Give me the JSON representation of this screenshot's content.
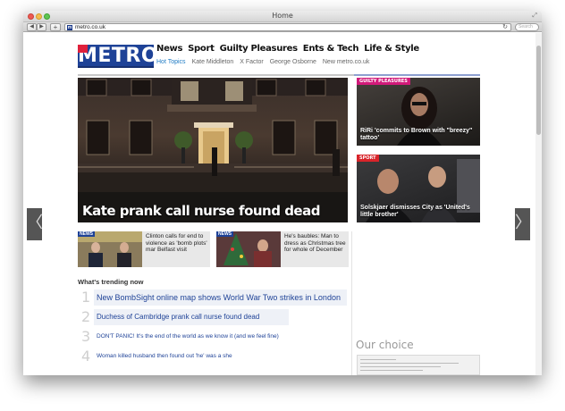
{
  "window": {
    "title": "Home"
  },
  "toolbar": {
    "url": "metro.co.uk",
    "search_placeholder": "Search",
    "favicon": "m"
  },
  "logo": {
    "text": "METRO"
  },
  "nav": {
    "main": [
      "News",
      "Sport",
      "Guilty Pleasures",
      "Ents & Tech",
      "Life & Style"
    ],
    "sub": [
      "Hot Topics",
      "Kate Middleton",
      "X Factor",
      "George Osborne",
      "New metro.co.uk"
    ]
  },
  "hero": {
    "headline": "Kate prank call nurse found dead"
  },
  "promos": [
    {
      "tag": "GUILTY PLEASURES",
      "caption": "RiRi 'commits to Brown with \"breezy\" tattoo'"
    },
    {
      "tag": "SPORT",
      "caption": "Solskjaer dismisses City as 'United's little brother'"
    }
  ],
  "cards": [
    {
      "tag": "NEWS",
      "text": "Clinton calls for end to violence as 'bomb plots' mar Belfast visit"
    },
    {
      "tag": "NEWS",
      "text": "He's baubles: Man to dress as Christmas tree for whole of December"
    }
  ],
  "trending": {
    "title": "What's trending now",
    "items": [
      {
        "num": "1",
        "text": "New BombSight online map shows World War Two strikes in London"
      },
      {
        "num": "2",
        "text": "Duchess of Cambridge prank call nurse found dead"
      },
      {
        "num": "3",
        "text": "DON'T PANIC! It's the end of the world as we know it (and we feel fine)"
      },
      {
        "num": "4",
        "text": "Woman killed husband then found out 'he' was a she"
      }
    ]
  },
  "our_choice": {
    "title": "Our choice"
  },
  "arrows": {
    "left": "〈",
    "right": "〉"
  }
}
